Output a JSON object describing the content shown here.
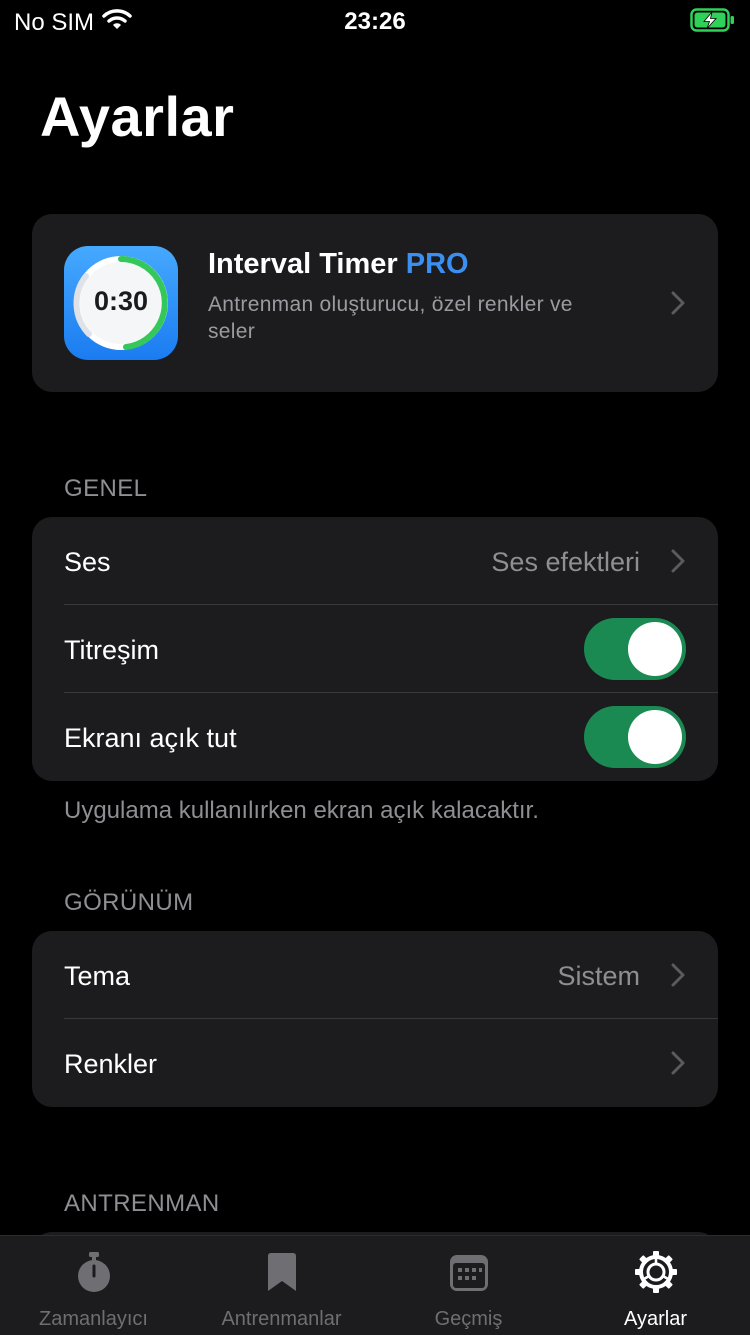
{
  "status_bar": {
    "carrier": "No SIM",
    "time": "23:26",
    "battery_icon": "battery-charging-icon",
    "battery_color": "#30d158"
  },
  "page": {
    "title": "Ayarlar"
  },
  "pro_card": {
    "icon_time": "0:30",
    "title": "Interval Timer",
    "badge": "PRO",
    "description": "Antrenman oluşturucu, özel renkler ve seler",
    "accent_color": "#3b8ff0"
  },
  "sections": {
    "general": {
      "header": "GENEL",
      "rows": [
        {
          "label": "Ses",
          "value": "Ses efektleri"
        },
        {
          "label": "Titreşim",
          "toggle": true
        },
        {
          "label": "Ekranı açık tut",
          "toggle": true
        }
      ],
      "footer": "Uygulama kullanılırken ekran açık kalacaktır."
    },
    "appearance": {
      "header": "GÖRÜNÜM",
      "rows": [
        {
          "label": "Tema",
          "value": "Sistem"
        },
        {
          "label": "Renkler"
        }
      ]
    },
    "workout": {
      "header": "ANTRENMAN"
    }
  },
  "tab_bar": {
    "active_index": 3,
    "items": [
      {
        "label": "Zamanlayıcı",
        "icon": "stopwatch-icon"
      },
      {
        "label": "Antrenmanlar",
        "icon": "bookmark-icon"
      },
      {
        "label": "Geçmiş",
        "icon": "calendar-icon"
      },
      {
        "label": "Ayarlar",
        "icon": "gear-icon"
      }
    ]
  },
  "colors": {
    "toggle_on": "#1a8a52",
    "card_background": "#1c1c1e",
    "secondary_text": "#8e8e93"
  }
}
